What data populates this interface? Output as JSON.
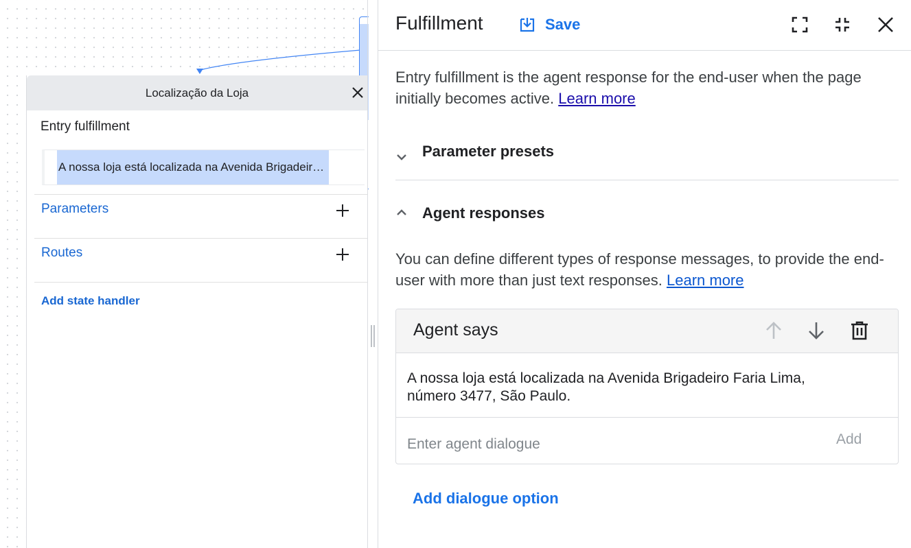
{
  "canvas": {
    "page_node": {
      "title": "Localização da Loja",
      "entry_fulfillment_label": "Entry fulfillment",
      "entry_preview": "A nossa loja está localizada na Avenida Brigadeiro Faria Lima, número 3477, São Paulo.",
      "rows": [
        {
          "label": "Parameters",
          "icon": "plus-icon"
        },
        {
          "label": "Routes",
          "icon": "plus-icon"
        }
      ],
      "add_state_handler": "Add state handler"
    }
  },
  "panel": {
    "title": "Fulfillment",
    "save_label": "Save",
    "header_icons": [
      "save-icon",
      "fullscreen-icon",
      "collapse-icon",
      "close-icon"
    ],
    "description": "Entry fulfillment is the agent response for the end-user when the page initially becomes active.",
    "learn_more": "Learn more",
    "sections": {
      "presets": {
        "title": "Parameter presets",
        "expanded": false
      },
      "responses": {
        "title": "Agent responses",
        "expanded": true
      }
    },
    "responses_description": "You can define different types of response messages, to provide the end-user with more than just text responses.",
    "responses_learn_more": "Learn more",
    "card": {
      "title": "Agent says",
      "icons": [
        "arrow-up-icon",
        "arrow-down-icon",
        "delete-icon"
      ],
      "response_text": "A nossa loja está localizada na Avenida Brigadeiro Faria Lima, número 3477, São Paulo.",
      "input_placeholder": "Enter agent dialogue",
      "add_label": "Add"
    },
    "add_dialogue_option": "Add dialogue option"
  },
  "colors": {
    "accent": "#1a73e8",
    "link": "#1a0dab",
    "selection": "#c6dafc",
    "node_header": "#e8eaed"
  }
}
